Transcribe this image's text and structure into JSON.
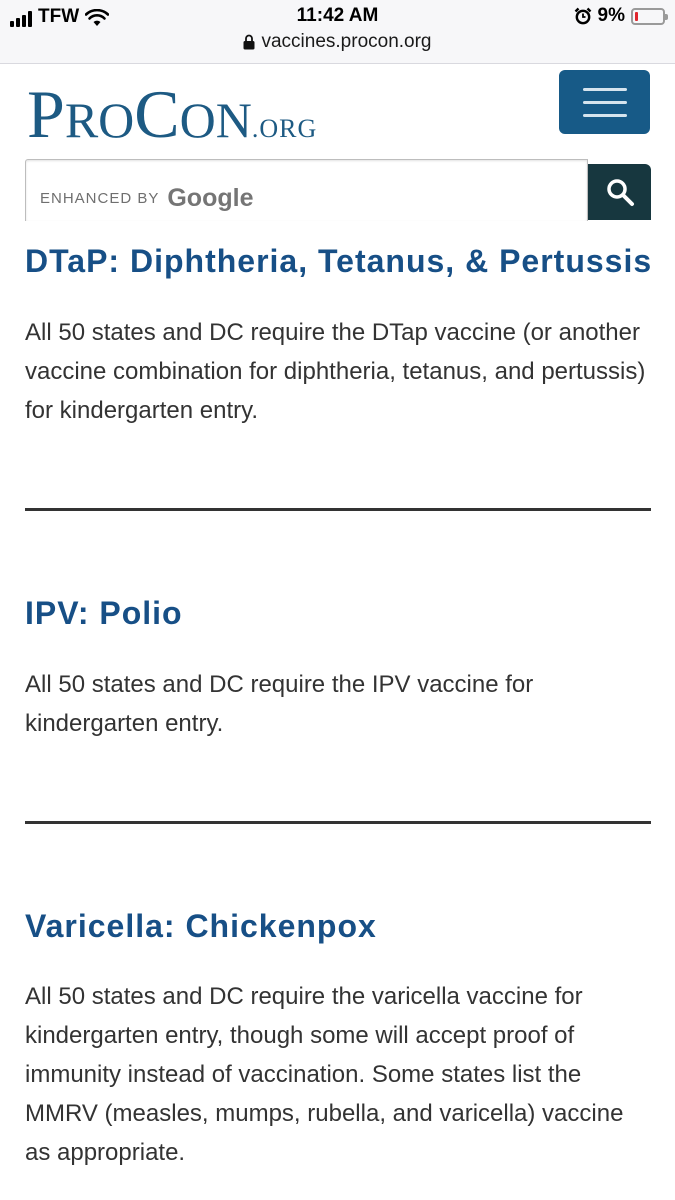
{
  "status_bar": {
    "carrier": "TFW",
    "time": "11:42 AM",
    "battery_percent": "9%",
    "battery_level": 0.09,
    "url": "vaccines.procon.org",
    "icons": [
      "signal-icon",
      "wifi-icon",
      "alarm-icon",
      "battery-icon",
      "lock-icon"
    ]
  },
  "header": {
    "logo_pro_p": "P",
    "logo_pro_rest": "RO",
    "logo_con_c": "C",
    "logo_con_rest": "ON",
    "logo_org": ".ORG",
    "menu_icon": "hamburger-menu-icon"
  },
  "search": {
    "enhanced_by": "ENHANCED BY",
    "google": "Google",
    "button_icon": "search-icon"
  },
  "sections": [
    {
      "title": "DTaP: Diphtheria, Tetanus, & Pertussis",
      "body": "All 50 states and DC require the DTap vaccine (or another vaccine combination for diphtheria, tetanus, and pertussis) for kindergarten entry."
    },
    {
      "title": "IPV: Polio",
      "body": "All 50 states and DC require the IPV vaccine for kindergarten entry."
    },
    {
      "title": "Varicella: Chickenpox",
      "body": "All 50 states and DC require the varicella vaccine for kindergarten entry, though some will accept proof of immunity instead of vaccination. Some states list the MMRV (measles, mumps, rubella, and varicella) vaccine as appropriate."
    }
  ],
  "colors": {
    "title_blue": "#174f86",
    "logo_blue": "#1d5a83",
    "menu_button": "#175a87",
    "search_button": "#17373f",
    "battery_low": "#e0262e"
  }
}
